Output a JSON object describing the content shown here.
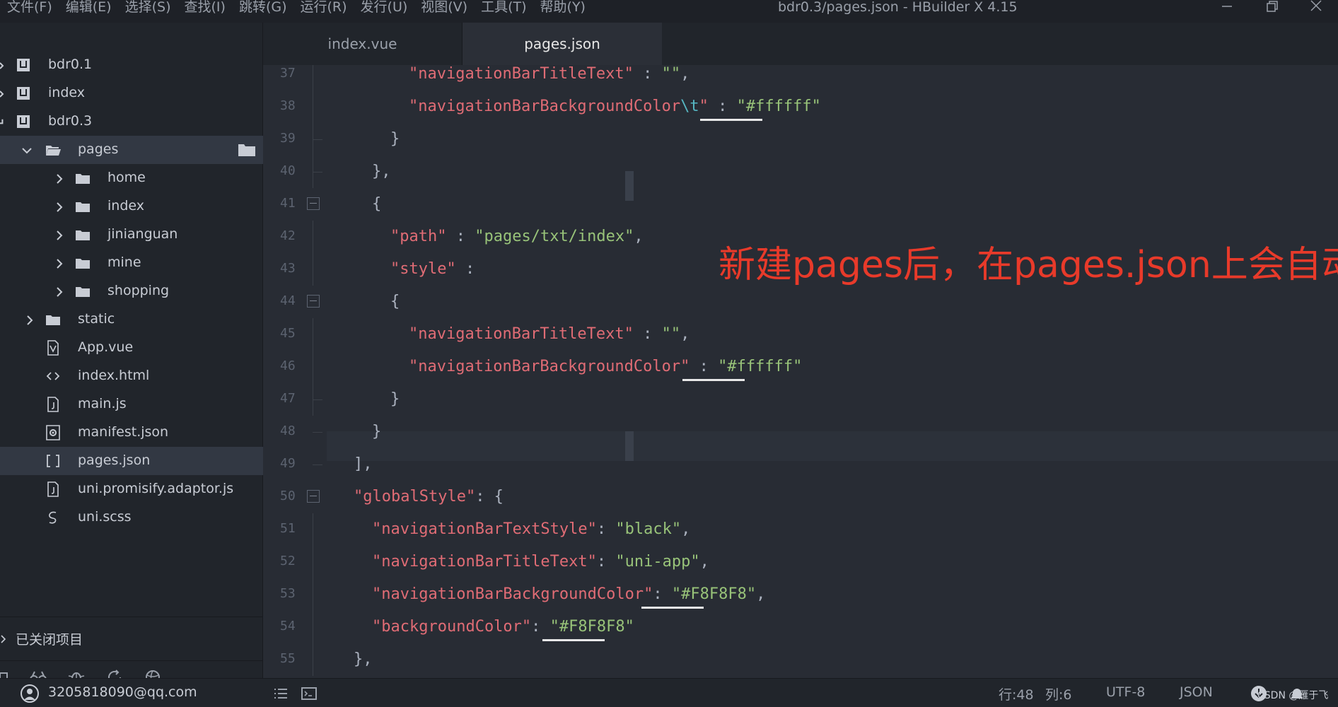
{
  "menu": [
    "文件(F)",
    "编辑(E)",
    "选择(S)",
    "查找(I)",
    "跳转(G)",
    "运行(R)",
    "发行(U)",
    "视图(V)",
    "工具(T)",
    "帮助(Y)"
  ],
  "window_title": "bdr0.3/pages.json - HBuilder X 4.15",
  "icons": {
    "minimize": "minimize-icon",
    "maximize": "restore-icon",
    "close": "close-icon",
    "project": "project-icon",
    "folder": "folder-icon",
    "file": "file-icon",
    "vue_file": "vue-file-icon",
    "html_file": "html-file-icon",
    "json_settings": "settings-file-icon",
    "json_brackets": "brackets-icon",
    "scss": "scss-icon"
  },
  "tree": [
    {
      "label": "bdr0.1",
      "icon": "project-icon"
    },
    {
      "label": "index",
      "icon": "project-icon"
    },
    {
      "label": "bdr0.3",
      "icon": "project-icon"
    },
    {
      "label": "pages",
      "icon": "folder-open-icon"
    },
    {
      "label": "home",
      "icon": "folder-icon"
    },
    {
      "label": "index",
      "icon": "folder-icon"
    },
    {
      "label": "jinianguan",
      "icon": "folder-icon"
    },
    {
      "label": "mine",
      "icon": "folder-icon"
    },
    {
      "label": "shopping",
      "icon": "folder-icon"
    },
    {
      "label": "static",
      "icon": "folder-icon"
    },
    {
      "label": "App.vue",
      "icon": "vue-file-icon"
    },
    {
      "label": "index.html",
      "icon": "html-file-icon"
    },
    {
      "label": "main.js",
      "icon": "js-file-icon"
    },
    {
      "label": "manifest.json",
      "icon": "settings-file-icon"
    },
    {
      "label": "pages.json",
      "icon": "brackets-icon"
    },
    {
      "label": "uni.promisify.adaptor.js",
      "icon": "js-file-icon"
    },
    {
      "label": "uni.scss",
      "icon": "scss-icon"
    }
  ],
  "closed_projects": "已关闭项目",
  "tabs": [
    "index.vue",
    "pages.json"
  ],
  "editor": {
    "line_numbers": [
      "37",
      "38",
      "39",
      "40",
      "41",
      "42",
      "43",
      "44",
      "45",
      "46",
      "47",
      "48",
      "49",
      "50",
      "51",
      "52",
      "53",
      "54",
      "55"
    ],
    "code": {
      "l37_key": "\"navigationBarTitleText\"",
      "l37_rest": " : ",
      "l37_val": "\"\"",
      "l37_tail": ",",
      "l38_key1": "\"navigationBarBackgroundColor",
      "l38_esc": "\\t",
      "l38_key2": "\"",
      "l38_rest": " : ",
      "l38_val": "\"#ffffff\"",
      "l39": "}",
      "l40": "},",
      "l41": "{",
      "l42_key": "\"path\"",
      "l42_rest": " : ",
      "l42_val": "\"pages/txt/index\"",
      "l42_tail": ",",
      "l43_key": "\"style\"",
      "l43_rest": " :",
      "l44": "{",
      "l45_key": "\"navigationBarTitleText\"",
      "l45_rest": " : ",
      "l45_val": "\"\"",
      "l45_tail": ",",
      "l46_key": "\"navigationBarBackgroundColor\"",
      "l46_rest": " : ",
      "l46_val": "\"#ffffff\"",
      "l47": "}",
      "l48": "}",
      "l49": "],",
      "l50_key": "\"globalStyle\"",
      "l50_rest": ": {",
      "l51_key": "\"navigationBarTextStyle\"",
      "l51_rest": ": ",
      "l51_val": "\"black\"",
      "l51_tail": ",",
      "l52_key": "\"navigationBarTitleText\"",
      "l52_rest": ": ",
      "l52_val": "\"uni-app\"",
      "l52_tail": ",",
      "l53_key": "\"navigationBarBackgroundColor\"",
      "l53_rest": ": ",
      "l53_val": "\"#F8F8F8\"",
      "l53_tail": ",",
      "l54_key": "\"backgroundColor\"",
      "l54_rest": ": ",
      "l54_val": "\"#F8F8F8\"",
      "l55": "},"
    }
  },
  "annotation": "新建pages后，在pages.json上会自动生成路径",
  "status": {
    "account": "3205818090@qq.com",
    "line": "行:48",
    "col": "列:6",
    "encoding": "UTF-8",
    "language": "JSON",
    "watermark": "CSDN @雁于飞"
  },
  "colors": {
    "key": "#e06c75",
    "string": "#98c379",
    "punct": "#abb2bf",
    "annotation": "#e83a2a",
    "editor_bg": "#282c34",
    "sidebar_bg": "#21252b"
  }
}
